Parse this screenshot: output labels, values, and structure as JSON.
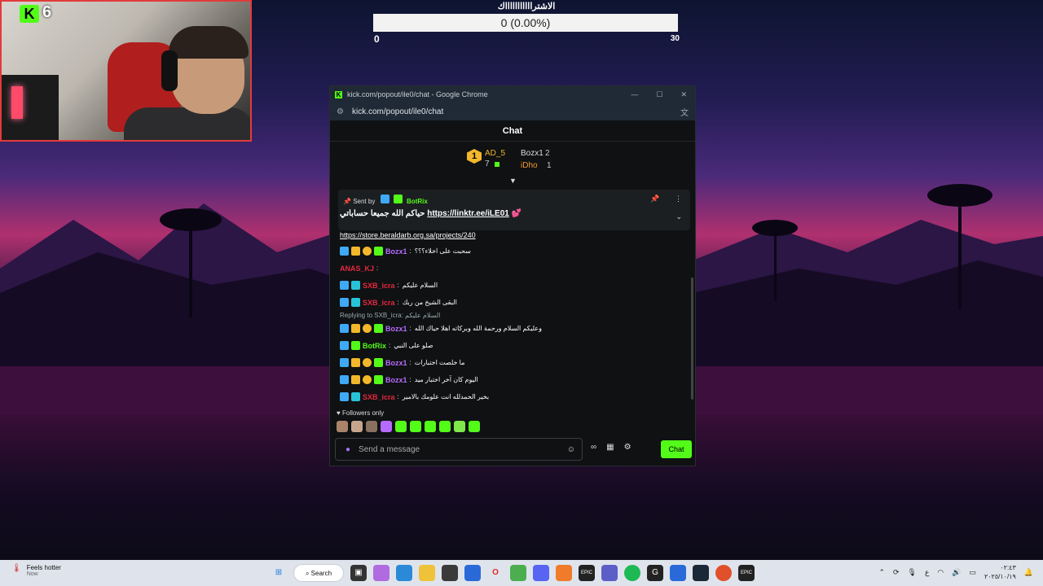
{
  "stream": {
    "kick_logo": "K",
    "viewer_count": "6"
  },
  "goal": {
    "title": "الاشتراااااااااااك",
    "progress_text": "0 (0.00%)",
    "progress_fraction": 0,
    "min": "0",
    "max": "30"
  },
  "window": {
    "title": "kick.com/popout/ile0/chat - Google Chrome",
    "url": "kick.com/popout/ile0/chat"
  },
  "chat": {
    "header": "Chat",
    "leaderboard": {
      "first_rank": "1",
      "first_name": "AD_5",
      "first_count": "7",
      "second_name": "Bozx1",
      "second_count": "2",
      "third_name": "iDho",
      "third_count": "1"
    },
    "pinned": {
      "sent_by_label": "Sent by",
      "sender": "BotRix",
      "text": "حياكم الله جميعا حساباتي",
      "link": "https://linktr.ee/iLE01"
    },
    "link_line": "https://store.beraldarb.org.sa/projects/240",
    "messages": [
      {
        "user": "Bozx1",
        "color": "#b66bff",
        "text": "سحبت على اخلاء؟؟؟",
        "badges": [
          "b-blue",
          "b-crown",
          "b-gold",
          "b-green"
        ]
      },
      {
        "user": "ANAS_KJ",
        "color": "#e6283e",
        "text": "",
        "badges": []
      },
      {
        "user": "SXB_icra",
        "color": "#e6283e",
        "text": "السلام عليكم",
        "badges": [
          "b-blue",
          "b-teal"
        ]
      },
      {
        "user": "SXB_icra",
        "color": "#e6283e",
        "text": "البقى الشيخ من ربك",
        "badges": [
          "b-blue",
          "b-teal"
        ]
      },
      {
        "reply": "Replying to SXB_icra: السلام عليكم"
      },
      {
        "user": "Bozx1",
        "color": "#b66bff",
        "text": "وعليكم السلام ورحمة الله وبركاته اهلا حياك الله",
        "badges": [
          "b-blue",
          "b-crown",
          "b-gold",
          "b-green"
        ]
      },
      {
        "user": "BotRix",
        "color": "#53fc18",
        "text": "صلو على النبي",
        "badges": [
          "b-blue",
          "b-green"
        ]
      },
      {
        "user": "Bozx1",
        "color": "#b66bff",
        "text": "ما خلصت اختبارات",
        "badges": [
          "b-blue",
          "b-crown",
          "b-gold",
          "b-green"
        ]
      },
      {
        "user": "Bozx1",
        "color": "#b66bff",
        "text": "اليوم كان آخر اختبار ميد",
        "badges": [
          "b-blue",
          "b-crown",
          "b-gold",
          "b-green"
        ]
      },
      {
        "user": "SXB_icra",
        "color": "#e6283e",
        "text": "بخير الحمدلله انت علومك بالامير",
        "badges": [
          "b-blue",
          "b-teal"
        ]
      }
    ],
    "followers_only": "Followers only",
    "input_placeholder": "Send a message",
    "send_label": "Chat"
  },
  "taskbar": {
    "weather_title": "Feels hotter",
    "weather_sub": "Now",
    "search_label": "Search",
    "time": "٠٢:٤٣",
    "date": "٢٠٢٥/١٠/١٩",
    "lang": "ع"
  },
  "colors": {
    "kick_green": "#53fc18",
    "chat_bg": "#0f1113",
    "webcam_border": "#e23b3b"
  }
}
